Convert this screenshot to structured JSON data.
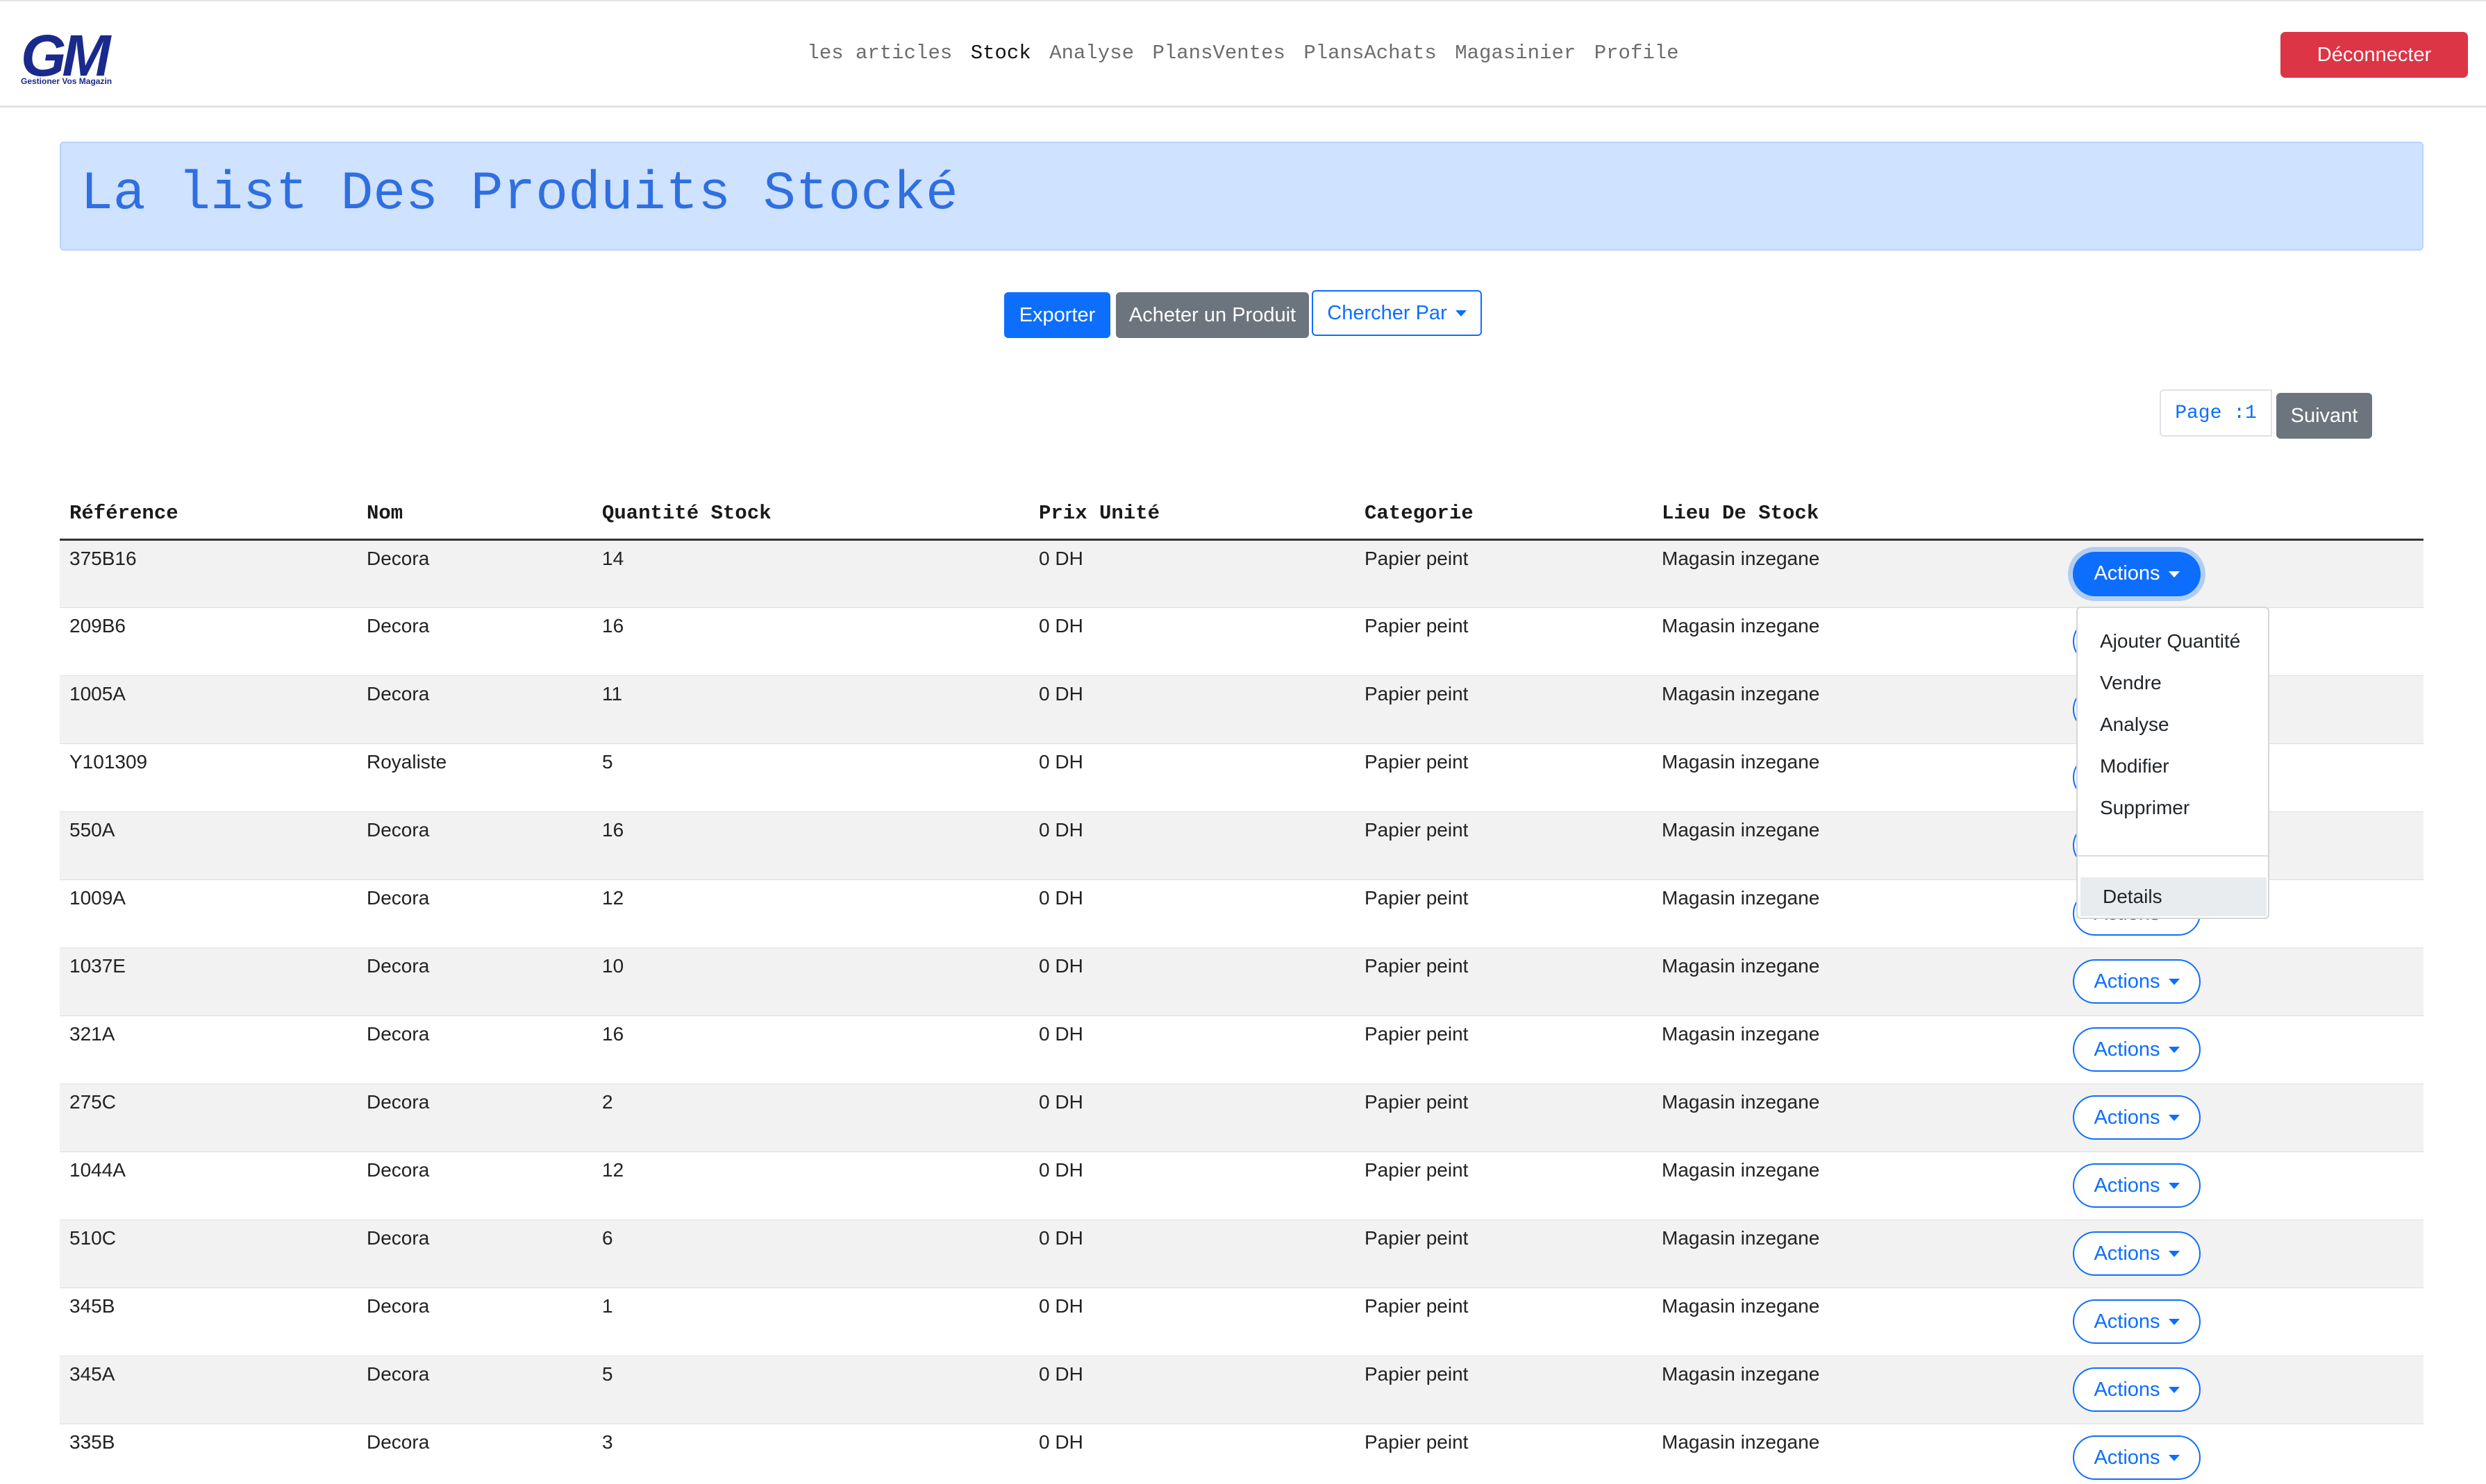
{
  "brand": {
    "logo_text": "GM",
    "tagline": "Gestioner Vos Magazin"
  },
  "nav": {
    "items": [
      "les articles",
      "Stock",
      "Analyse",
      "PlansVentes",
      "PlansAchats",
      "Magasinier",
      "Profile"
    ],
    "active": "Stock",
    "logout_label": "Déconnecter"
  },
  "page_title": "La list Des Produits Stocké",
  "toolbar": {
    "export_label": "Exporter",
    "buy_label": "Acheter un Produit",
    "search_by_label": "Chercher Par"
  },
  "pagination": {
    "page_label": "Page :1",
    "next_label": "Suivant"
  },
  "table": {
    "columns": [
      "Référence",
      "Nom",
      "Quantité Stock",
      "Prix Unité",
      "Categorie",
      "Lieu De Stock",
      ""
    ],
    "action_label": "Actions",
    "rows": [
      [
        "375B16",
        "Decora",
        "14",
        "0 DH",
        "Papier peint",
        "Magasin inzegane"
      ],
      [
        "209B6",
        "Decora",
        "16",
        "0 DH",
        "Papier peint",
        "Magasin inzegane"
      ],
      [
        "1005A",
        "Decora",
        "11",
        "0 DH",
        "Papier peint",
        "Magasin inzegane"
      ],
      [
        "Y101309",
        "Royaliste",
        "5",
        "0 DH",
        "Papier peint",
        "Magasin inzegane"
      ],
      [
        "550A",
        "Decora",
        "16",
        "0 DH",
        "Papier peint",
        "Magasin inzegane"
      ],
      [
        "1009A",
        "Decora",
        "12",
        "0 DH",
        "Papier peint",
        "Magasin inzegane"
      ],
      [
        "1037E",
        "Decora",
        "10",
        "0 DH",
        "Papier peint",
        "Magasin inzegane"
      ],
      [
        "321A",
        "Decora",
        "16",
        "0 DH",
        "Papier peint",
        "Magasin inzegane"
      ],
      [
        "275C",
        "Decora",
        "2",
        "0 DH",
        "Papier peint",
        "Magasin inzegane"
      ],
      [
        "1044A",
        "Decora",
        "12",
        "0 DH",
        "Papier peint",
        "Magasin inzegane"
      ],
      [
        "510C",
        "Decora",
        "6",
        "0 DH",
        "Papier peint",
        "Magasin inzegane"
      ],
      [
        "345B",
        "Decora",
        "1",
        "0 DH",
        "Papier peint",
        "Magasin inzegane"
      ],
      [
        "345A",
        "Decora",
        "5",
        "0 DH",
        "Papier peint",
        "Magasin inzegane"
      ],
      [
        "335B",
        "Decora",
        "3",
        "0 DH",
        "Papier peint",
        "Magasin inzegane"
      ]
    ]
  },
  "actions_menu": {
    "open_row": 0,
    "items": [
      "Ajouter Quantité",
      "Vendre",
      "Analyse",
      "Modifier",
      "Supprimer"
    ],
    "footer_item": "Details",
    "highlighted_item": "Details"
  },
  "colors": {
    "primary": "#0d6efd",
    "secondary": "#6c757d",
    "danger": "#dc3545",
    "banner_bg": "#cfe2ff",
    "banner_text": "#2f6fe0",
    "logo": "#1a2a8c"
  }
}
